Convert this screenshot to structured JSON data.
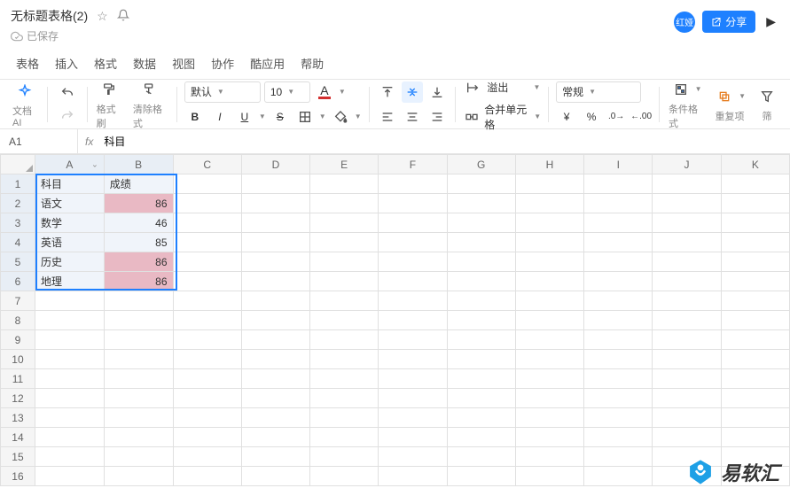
{
  "title": "无标题表格(2)",
  "saved_status": "已保存",
  "avatar_text": "红娅",
  "share_label": "分享",
  "menubar": [
    "表格",
    "插入",
    "格式",
    "数据",
    "视图",
    "协作",
    "酷应用",
    "帮助"
  ],
  "toolbar": {
    "doc_ai": "文档AI",
    "brush": "格式刷",
    "clear_fmt": "清除格式",
    "font_name": "默认",
    "font_size": "10",
    "overflow": "溢出",
    "merge": "合并单元格",
    "number_fmt": "常规",
    "cond_fmt": "条件格式",
    "dup": "重复项",
    "filter": "筛"
  },
  "name_box": "A1",
  "formula_value": "科目",
  "columns": [
    "A",
    "B",
    "C",
    "D",
    "E",
    "F",
    "G",
    "H",
    "I",
    "J",
    "K"
  ],
  "row_count": 16,
  "selected_cols": [
    "A",
    "B"
  ],
  "selected_rows": [
    1,
    2,
    3,
    4,
    5,
    6
  ],
  "chart_data": {
    "type": "table",
    "headers": [
      "科目",
      "成绩"
    ],
    "rows": [
      {
        "subject": "语文",
        "score": 86,
        "highlight": true
      },
      {
        "subject": "数学",
        "score": 46,
        "highlight": false
      },
      {
        "subject": "英语",
        "score": 85,
        "highlight": false
      },
      {
        "subject": "历史",
        "score": 86,
        "highlight": true
      },
      {
        "subject": "地理",
        "score": 86,
        "highlight": true
      }
    ]
  },
  "watermark": "易软汇"
}
